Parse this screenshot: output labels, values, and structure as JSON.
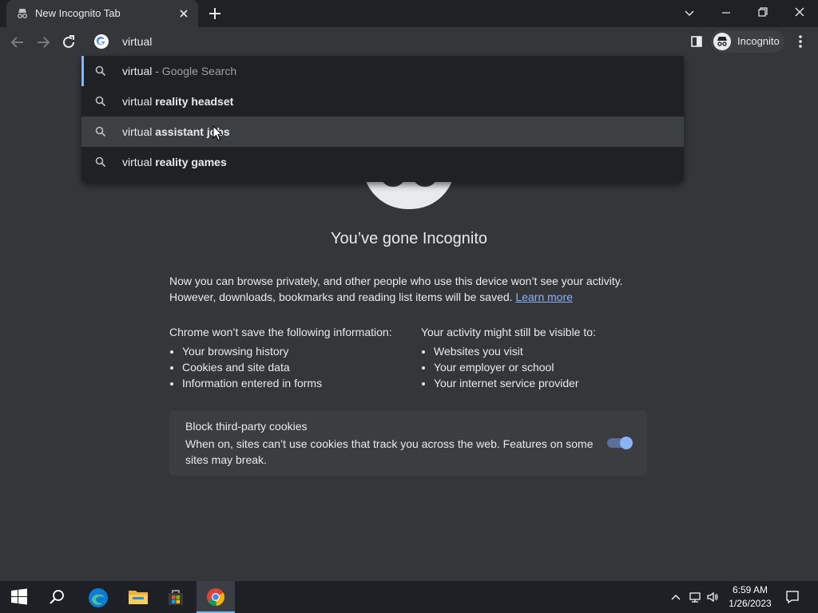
{
  "browser": {
    "tab": {
      "title": "New Incognito Tab"
    },
    "omnibox": {
      "text": "virtual"
    },
    "profile_label": "Incognito"
  },
  "suggestions": [
    {
      "prefix": "virtual",
      "bold": "",
      "suffix": " - Google Search",
      "highlighted": false,
      "selected": true
    },
    {
      "prefix": "virtual ",
      "bold": "reality headset",
      "suffix": "",
      "highlighted": false,
      "selected": false
    },
    {
      "prefix": "virtual ",
      "bold": "assistant jobs",
      "suffix": "",
      "highlighted": true,
      "selected": false
    },
    {
      "prefix": "virtual ",
      "bold": "reality games",
      "suffix": "",
      "highlighted": false,
      "selected": false
    }
  ],
  "page": {
    "heading": "You’ve gone Incognito",
    "intro": "Now you can browse privately, and other people who use this device won’t see your activity. However, downloads, bookmarks and reading list items will be saved.",
    "learn_more": "Learn more",
    "left_col": {
      "title": "Chrome won’t save the following information:",
      "items": [
        "Your browsing history",
        "Cookies and site data",
        "Information entered in forms"
      ]
    },
    "right_col": {
      "title_pre": "Your activity ",
      "title_bold": "might",
      "title_post": " still be visible to:",
      "items": [
        "Websites you visit",
        "Your employer or school",
        "Your internet service provider"
      ]
    },
    "cookies": {
      "title": "Block third-party cookies",
      "description": "When on, sites can’t use cookies that track you across the web. Features on some sites may break.",
      "enabled": true
    }
  },
  "taskbar": {
    "time": "6:59 AM",
    "date": "1/26/2023",
    "apps": [
      "start-icon",
      "search-icon",
      "edge-icon",
      "file-explorer-icon",
      "store-icon",
      "chrome-icon"
    ]
  },
  "colors": {
    "accent": "#8ab4f8",
    "background": "#35363a",
    "frame": "#202124"
  }
}
